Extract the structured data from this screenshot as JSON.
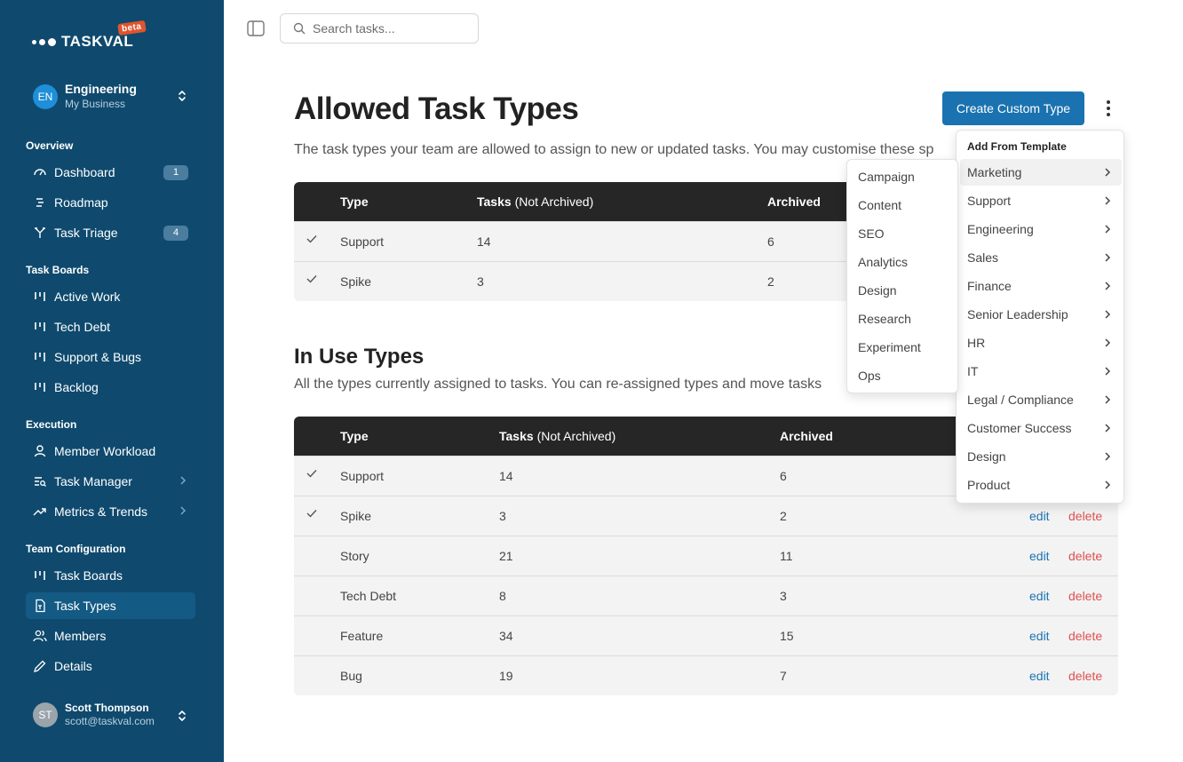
{
  "app": {
    "name": "TASKVAL",
    "badge": "beta"
  },
  "org": {
    "initials": "EN",
    "name": "Engineering",
    "sub": "My Business"
  },
  "nav": {
    "overview_title": "Overview",
    "dashboard": "Dashboard",
    "dashboard_badge": "1",
    "roadmap": "Roadmap",
    "triage": "Task Triage",
    "triage_badge": "4",
    "boards_title": "Task Boards",
    "active_work": "Active Work",
    "tech_debt": "Tech Debt",
    "support_bugs": "Support & Bugs",
    "backlog": "Backlog",
    "execution_title": "Execution",
    "member_workload": "Member Workload",
    "task_manager": "Task Manager",
    "metrics": "Metrics & Trends",
    "config_title": "Team Configuration",
    "task_boards": "Task Boards",
    "task_types": "Task Types",
    "members": "Members",
    "details": "Details"
  },
  "user": {
    "initials": "ST",
    "name": "Scott Thompson",
    "email": "scott@taskval.com"
  },
  "search": {
    "placeholder": "Search tasks..."
  },
  "page": {
    "title": "Allowed Task Types",
    "description": "The task types your team are allowed to assign to new or updated tasks. You may customise these sp",
    "create_button": "Create Custom Type"
  },
  "allowed_table": {
    "headers": {
      "type": "Type",
      "tasks": "Tasks",
      "tasks_note": "(Not Archived)",
      "archived": "Archived"
    },
    "rows": [
      {
        "type": "Support",
        "tasks": "14",
        "archived": "6"
      },
      {
        "type": "Spike",
        "tasks": "3",
        "archived": "2"
      }
    ]
  },
  "in_use": {
    "title": "In Use Types",
    "description": "All the types currently assigned to tasks. You can re-assigned types and move tasks",
    "headers": {
      "type": "Type",
      "tasks": "Tasks",
      "tasks_note": "(Not Archived)",
      "archived": "Archived"
    },
    "rows": [
      {
        "type": "Support",
        "tasks": "14",
        "archived": "6",
        "edit": "",
        "delete": ""
      },
      {
        "type": "Spike",
        "tasks": "3",
        "archived": "2",
        "edit": "edit",
        "delete": "delete"
      },
      {
        "type": "Story",
        "tasks": "21",
        "archived": "11",
        "edit": "edit",
        "delete": "delete"
      },
      {
        "type": "Tech Debt",
        "tasks": "8",
        "archived": "3",
        "edit": "edit",
        "delete": "delete"
      },
      {
        "type": "Feature",
        "tasks": "34",
        "archived": "15",
        "edit": "edit",
        "delete": "delete"
      },
      {
        "type": "Bug",
        "tasks": "19",
        "archived": "7",
        "edit": "edit",
        "delete": "delete"
      }
    ]
  },
  "template_menu": {
    "title": "Add From Template",
    "items": [
      "Marketing",
      "Support",
      "Engineering",
      "Sales",
      "Finance",
      "Senior Leadership",
      "HR",
      "IT",
      "Legal / Compliance",
      "Customer Success",
      "Design",
      "Product"
    ]
  },
  "marketing_submenu": {
    "items": [
      "Campaign",
      "Content",
      "SEO",
      "Analytics",
      "Design",
      "Research",
      "Experiment",
      "Ops"
    ]
  }
}
